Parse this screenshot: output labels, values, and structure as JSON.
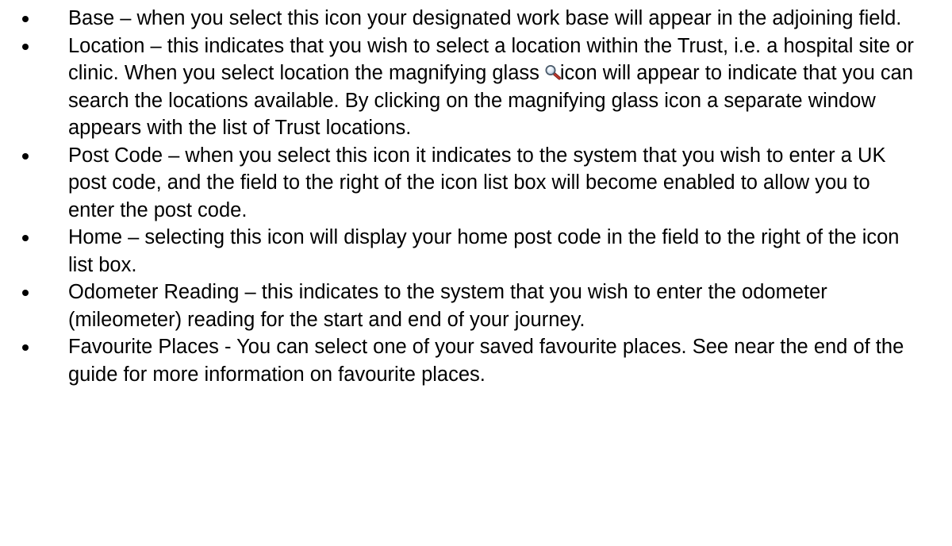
{
  "items": [
    {
      "text": "Base – when you select this icon your designated work base will appear in the adjoining field."
    },
    {
      "text_before_icon": "Location – this indicates that you wish to select a location within the Trust, i.e. a hospital site or clinic.  When you select location the magnifying glass",
      "icon": "magnifying-glass-icon",
      "text_after_icon": "icon will appear to indicate that you can search the locations available.  By clicking on the magnifying glass icon a separate window appears with the list of Trust locations."
    },
    {
      "text": "Post Code – when you select this icon it indicates to the system that you wish to enter a UK post code, and the field to the right of the icon list box will become enabled to allow you to enter the post code."
    },
    {
      "text": "Home – selecting this icon will display your home post code in the field to the right of the icon list box."
    },
    {
      "text": "Odometer Reading – this indicates to the system that you wish to enter the odometer (mileometer) reading for the start and end of your journey."
    },
    {
      "text": "Favourite Places - You can select one of your saved favourite places. See near the end of the guide for more information on favourite places."
    }
  ]
}
